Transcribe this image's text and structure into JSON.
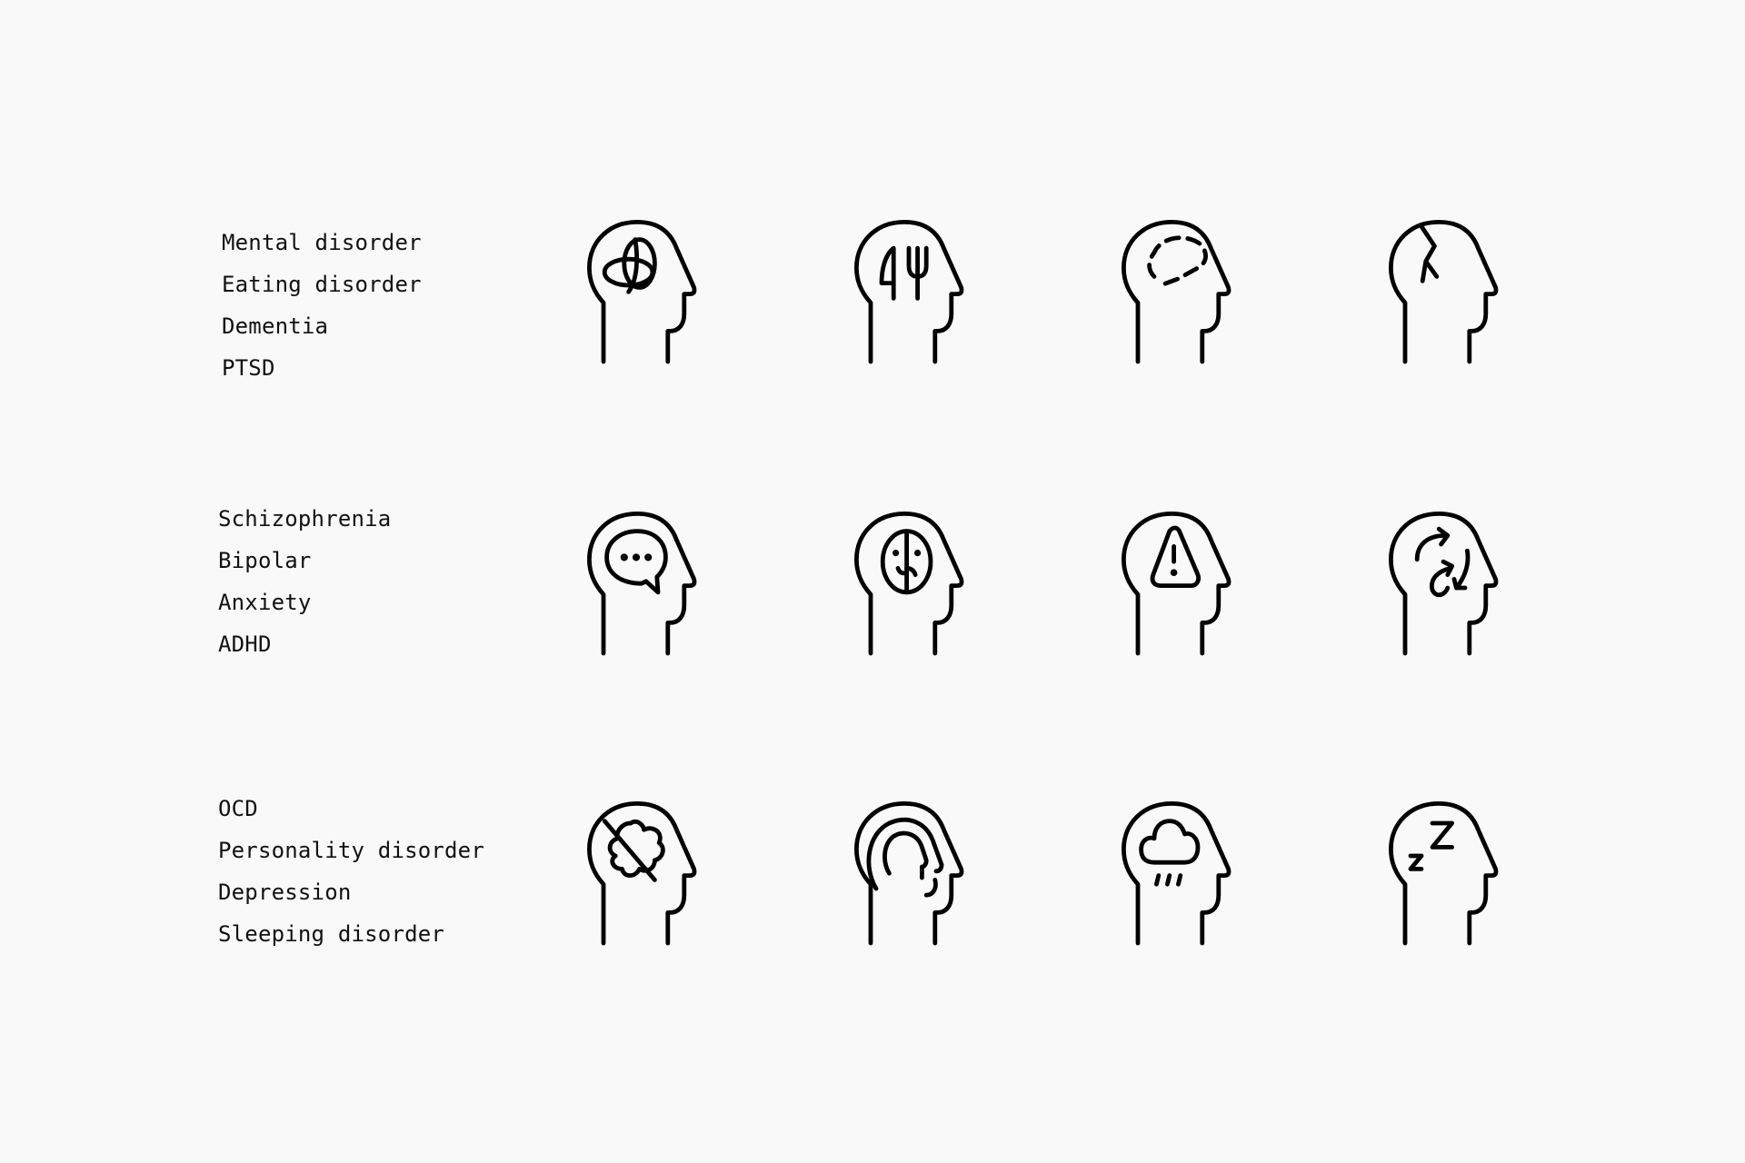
{
  "background": "#f9f9f9",
  "ink": "#000000",
  "groups": [
    {
      "labels": [
        "Mental disorder",
        "Eating disorder",
        "Dementia",
        "PTSD"
      ],
      "icons": [
        "head-knot-icon",
        "head-knife-fork-icon",
        "head-dashed-brain-icon",
        "head-crack-icon"
      ]
    },
    {
      "labels": [
        "Schizophrenia",
        "Bipolar",
        "Anxiety",
        "ADHD"
      ],
      "icons": [
        "head-speech-bubble-icon",
        "head-split-face-icon",
        "head-warning-icon",
        "head-cycle-arrows-icon"
      ]
    },
    {
      "labels": [
        "OCD",
        "Personality disorder",
        "Depression",
        "Sleeping disorder"
      ],
      "icons": [
        "head-crossed-brain-icon",
        "head-concentric-profile-icon",
        "head-rain-cloud-icon",
        "head-zzz-icon"
      ]
    }
  ]
}
